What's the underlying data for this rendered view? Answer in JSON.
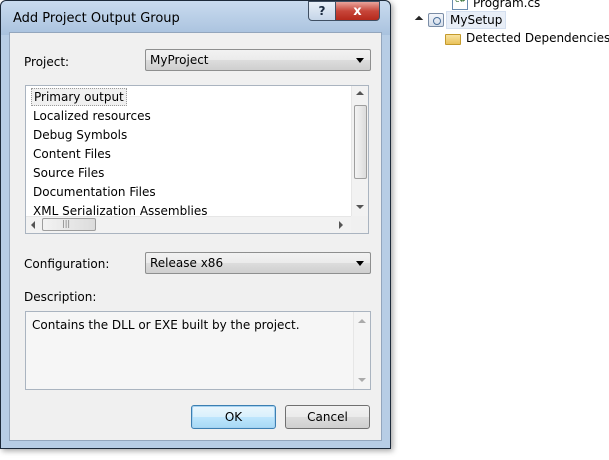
{
  "explorer": {
    "items": [
      {
        "label": "Program.cs"
      },
      {
        "label": "MySetup"
      },
      {
        "label": "Detected Dependencies"
      }
    ]
  },
  "dialog": {
    "title": "Add Project Output Group",
    "help_label": "?",
    "close_label": "x",
    "project_label": "Project:",
    "project_value": "MyProject",
    "outputs": [
      "Primary output",
      "Localized resources",
      "Debug Symbols",
      "Content Files",
      "Source Files",
      "Documentation Files",
      "XML Serialization Assemblies"
    ],
    "scroll_grip": "|||",
    "configuration_label": "Configuration:",
    "configuration_value": "Release x86",
    "description_label": "Description:",
    "description_text": "Contains the DLL or EXE built by the project.",
    "ok_label": "OK",
    "cancel_label": "Cancel"
  }
}
